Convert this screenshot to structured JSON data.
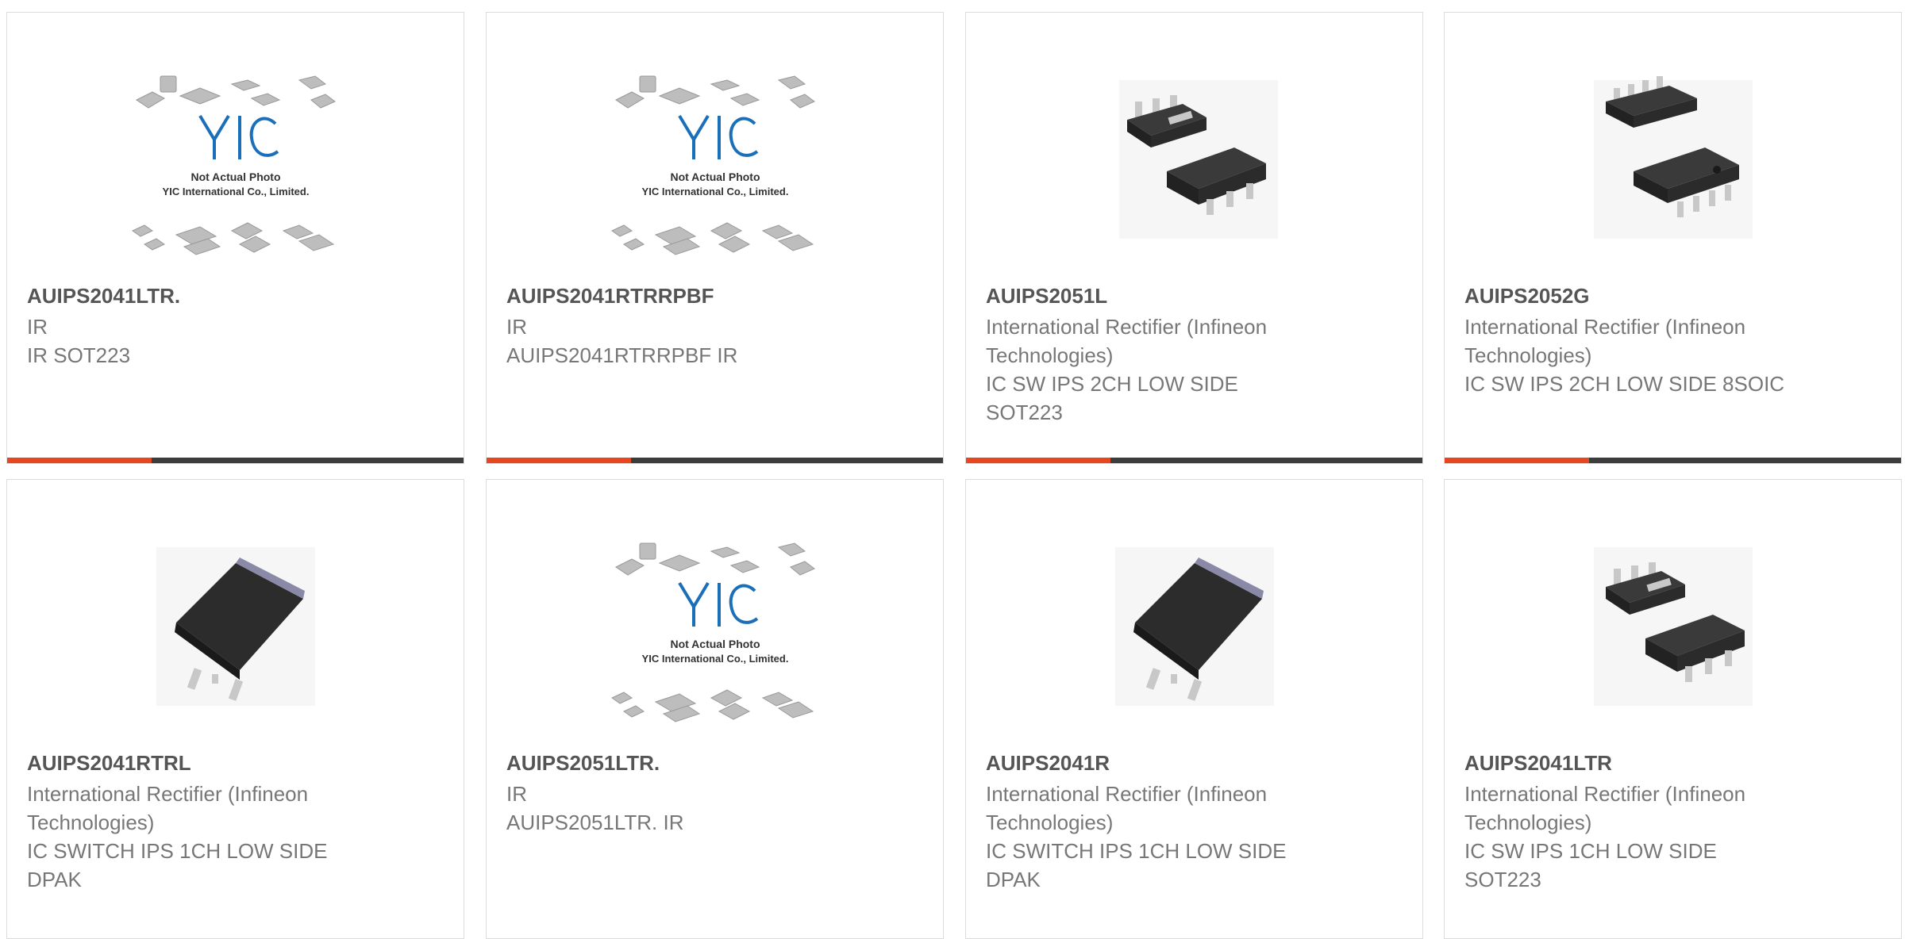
{
  "products": [
    {
      "part": "AUIPS2041LTR.",
      "mfr": "IR",
      "desc": "IR SOT223",
      "image": "yic-placeholder",
      "image_caption_1": "Not Actual Photo",
      "image_caption_2": "YIC International Co., Limited."
    },
    {
      "part": "AUIPS2041RTRRPBF",
      "mfr": "IR",
      "desc": "AUIPS2041RTRRPBF IR",
      "image": "yic-placeholder",
      "image_caption_1": "Not Actual Photo",
      "image_caption_2": "YIC International Co., Limited."
    },
    {
      "part": "AUIPS2051L",
      "mfr": "International Rectifier (Infineon Technologies)",
      "desc": "IC SW IPS 2CH LOW SIDE SOT223",
      "image": "sot223-package"
    },
    {
      "part": "AUIPS2052G",
      "mfr": "International Rectifier (Infineon Technologies)",
      "desc": "IC SW IPS 2CH LOW SIDE 8SOIC",
      "image": "soic8-package"
    },
    {
      "part": "AUIPS2041RTRL",
      "mfr": "International Rectifier (Infineon Technologies)",
      "desc": "IC SWITCH IPS 1CH LOW SIDE DPAK",
      "image": "dpak-package"
    },
    {
      "part": "AUIPS2051LTR.",
      "mfr": "IR",
      "desc": "AUIPS2051LTR. IR",
      "image": "yic-placeholder",
      "image_caption_1": "Not Actual Photo",
      "image_caption_2": "YIC International Co., Limited."
    },
    {
      "part": "AUIPS2041R",
      "mfr": "International Rectifier (Infineon Technologies)",
      "desc": "IC SWITCH IPS 1CH LOW SIDE DPAK",
      "image": "dpak-package"
    },
    {
      "part": "AUIPS2041LTR",
      "mfr": "International Rectifier (Infineon Technologies)",
      "desc": "IC SW IPS 1CH LOW SIDE SOT223",
      "image": "sot223-package"
    }
  ],
  "colors": {
    "accent": "#e8461e",
    "bar": "#3c3c3c",
    "logo": "#1a6fb8"
  }
}
